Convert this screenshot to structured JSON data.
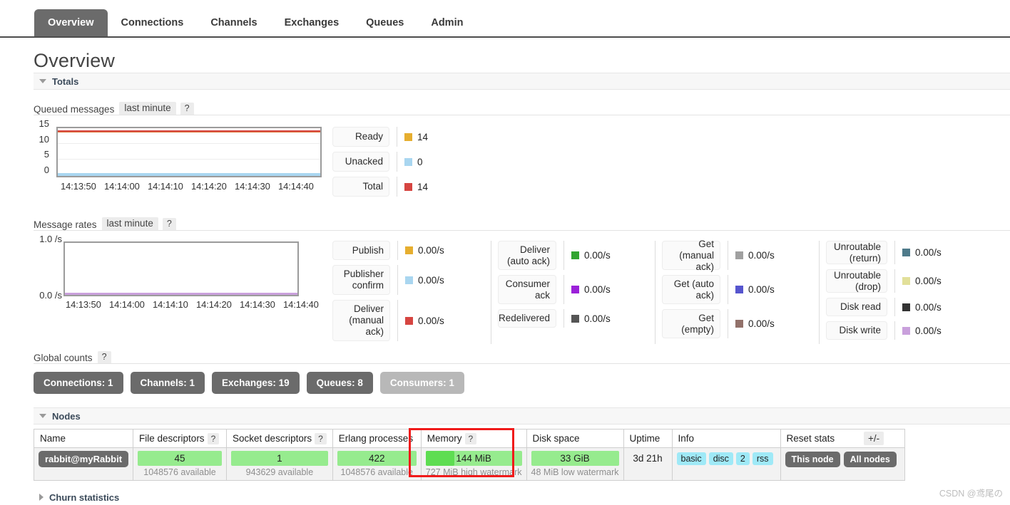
{
  "nav": {
    "items": [
      {
        "label": "Overview",
        "active": true
      },
      {
        "label": "Connections",
        "active": false
      },
      {
        "label": "Channels",
        "active": false
      },
      {
        "label": "Exchanges",
        "active": false
      },
      {
        "label": "Queues",
        "active": false
      },
      {
        "label": "Admin",
        "active": false
      }
    ]
  },
  "page": {
    "title": "Overview"
  },
  "sections": {
    "totals": {
      "label": "Totals",
      "expanded": true
    },
    "nodes": {
      "label": "Nodes",
      "expanded": true
    },
    "churn": {
      "label": "Churn statistics",
      "expanded": false
    }
  },
  "queued_messages": {
    "title": "Queued messages",
    "period": "last minute",
    "help": "?",
    "stats": [
      {
        "label": "Ready",
        "value": "14",
        "color": "#e6ae2f"
      },
      {
        "label": "Unacked",
        "value": "0",
        "color": "#a9d6f0"
      },
      {
        "label": "Total",
        "value": "14",
        "color": "#d64541"
      }
    ]
  },
  "message_rates": {
    "title": "Message rates",
    "period": "last minute",
    "help": "?",
    "columns": [
      [
        {
          "label": "Publish",
          "value": "0.00/s",
          "color": "#e6ae2f"
        },
        {
          "label": "Publisher confirm",
          "value": "0.00/s",
          "color": "#a9d6f0"
        },
        {
          "label": "Deliver (manual ack)",
          "value": "0.00/s",
          "color": "#d64541"
        }
      ],
      [
        {
          "label": "Deliver (auto ack)",
          "value": "0.00/s",
          "color": "#33a532"
        },
        {
          "label": "Consumer ack",
          "value": "0.00/s",
          "color": "#9b20d9"
        },
        {
          "label": "Redelivered",
          "value": "0.00/s",
          "color": "#555555"
        }
      ],
      [
        {
          "label": "Get (manual ack)",
          "value": "0.00/s",
          "color": "#a0a0a0"
        },
        {
          "label": "Get (auto ack)",
          "value": "0.00/s",
          "color": "#5655ce"
        },
        {
          "label": "Get (empty)",
          "value": "0.00/s",
          "color": "#92716a"
        }
      ],
      [
        {
          "label": "Unroutable (return)",
          "value": "0.00/s",
          "color": "#4e7a8a"
        },
        {
          "label": "Unroutable (drop)",
          "value": "0.00/s",
          "color": "#e2e09a"
        },
        {
          "label": "Disk read",
          "value": "0.00/s",
          "color": "#333333"
        },
        {
          "label": "Disk write",
          "value": "0.00/s",
          "color": "#c9a0dc"
        }
      ]
    ]
  },
  "global_counts": {
    "title": "Global counts",
    "help": "?",
    "pills": [
      {
        "label": "Connections: 1",
        "muted": false
      },
      {
        "label": "Channels: 1",
        "muted": false
      },
      {
        "label": "Exchanges: 19",
        "muted": false
      },
      {
        "label": "Queues: 8",
        "muted": false
      },
      {
        "label": "Consumers: 1",
        "muted": true
      }
    ]
  },
  "nodes_table": {
    "headers": [
      {
        "label": "Name",
        "help": null
      },
      {
        "label": "File descriptors",
        "help": "?"
      },
      {
        "label": "Socket descriptors",
        "help": "?"
      },
      {
        "label": "Erlang processes",
        "help": null
      },
      {
        "label": "Memory",
        "help": "?"
      },
      {
        "label": "Disk space",
        "help": null
      },
      {
        "label": "Uptime",
        "help": null
      },
      {
        "label": "Info",
        "help": null
      },
      {
        "label": "Reset stats",
        "help": null
      }
    ],
    "toggle_columns": "+/-",
    "row": {
      "name": "rabbit@myRabbit",
      "file_descriptors": {
        "value": "45",
        "note": "1048576 available",
        "fill_pct": 0
      },
      "socket_descriptors": {
        "value": "1",
        "note": "943629 available",
        "fill_pct": 0
      },
      "erlang_processes": {
        "value": "422",
        "note": "1048576 available",
        "fill_pct": 0
      },
      "memory": {
        "value": "144 MiB",
        "note": "727 MiB high watermark",
        "fill_pct": 20
      },
      "disk_space": {
        "value": "33 GiB",
        "note": "48 MiB low watermark",
        "fill_pct": 0
      },
      "uptime": "3d 21h",
      "info_tags": [
        "basic",
        "disc",
        "2",
        "rss"
      ],
      "reset_buttons": [
        "This node",
        "All nodes"
      ]
    }
  },
  "chart_data": [
    {
      "type": "line",
      "title": "Queued messages",
      "xlabel": "",
      "ylabel": "",
      "ylim": [
        0,
        15
      ],
      "yticks": [
        "15",
        "10",
        "5",
        "0"
      ],
      "x": [
        "14:13:50",
        "14:14:00",
        "14:14:10",
        "14:14:20",
        "14:14:30",
        "14:14:40"
      ],
      "grid": true,
      "legend": "right",
      "series": [
        {
          "name": "Ready",
          "color": "#e6ae2f",
          "values": [
            14,
            14,
            14,
            14,
            14,
            14
          ]
        },
        {
          "name": "Unacked",
          "color": "#a9d6f0",
          "values": [
            0,
            0,
            0,
            0,
            0,
            0
          ]
        },
        {
          "name": "Total",
          "color": "#d64541",
          "values": [
            14,
            14,
            14,
            14,
            14,
            14
          ]
        }
      ]
    },
    {
      "type": "line",
      "title": "Message rates",
      "xlabel": "",
      "ylabel": "",
      "ylim": [
        0,
        1
      ],
      "yticks": [
        "1.0 /s",
        "0.0 /s"
      ],
      "x": [
        "14:13:50",
        "14:14:00",
        "14:14:10",
        "14:14:20",
        "14:14:30",
        "14:14:40"
      ],
      "grid": false,
      "legend": "right",
      "series": [
        {
          "name": "Publish",
          "color": "#e6ae2f",
          "values": [
            0,
            0,
            0,
            0,
            0,
            0
          ]
        },
        {
          "name": "Publisher confirm",
          "color": "#a9d6f0",
          "values": [
            0,
            0,
            0,
            0,
            0,
            0
          ]
        },
        {
          "name": "Deliver (manual ack)",
          "color": "#d64541",
          "values": [
            0,
            0,
            0,
            0,
            0,
            0
          ]
        },
        {
          "name": "Deliver (auto ack)",
          "color": "#33a532",
          "values": [
            0,
            0,
            0,
            0,
            0,
            0
          ]
        },
        {
          "name": "Consumer ack",
          "color": "#9b20d9",
          "values": [
            0,
            0,
            0,
            0,
            0,
            0
          ]
        },
        {
          "name": "Redelivered",
          "color": "#555555",
          "values": [
            0,
            0,
            0,
            0,
            0,
            0
          ]
        },
        {
          "name": "Get (manual ack)",
          "color": "#a0a0a0",
          "values": [
            0,
            0,
            0,
            0,
            0,
            0
          ]
        },
        {
          "name": "Get (auto ack)",
          "color": "#5655ce",
          "values": [
            0,
            0,
            0,
            0,
            0,
            0
          ]
        },
        {
          "name": "Get (empty)",
          "color": "#92716a",
          "values": [
            0,
            0,
            0,
            0,
            0,
            0
          ]
        },
        {
          "name": "Unroutable (return)",
          "color": "#4e7a8a",
          "values": [
            0,
            0,
            0,
            0,
            0,
            0
          ]
        },
        {
          "name": "Unroutable (drop)",
          "color": "#e2e09a",
          "values": [
            0,
            0,
            0,
            0,
            0,
            0
          ]
        },
        {
          "name": "Disk read",
          "color": "#333333",
          "values": [
            0,
            0,
            0,
            0,
            0,
            0
          ]
        },
        {
          "name": "Disk write",
          "color": "#c9a0dc",
          "values": [
            0,
            0,
            0,
            0,
            0,
            0
          ]
        }
      ]
    }
  ],
  "watermark": "CSDN @鸢尾の"
}
